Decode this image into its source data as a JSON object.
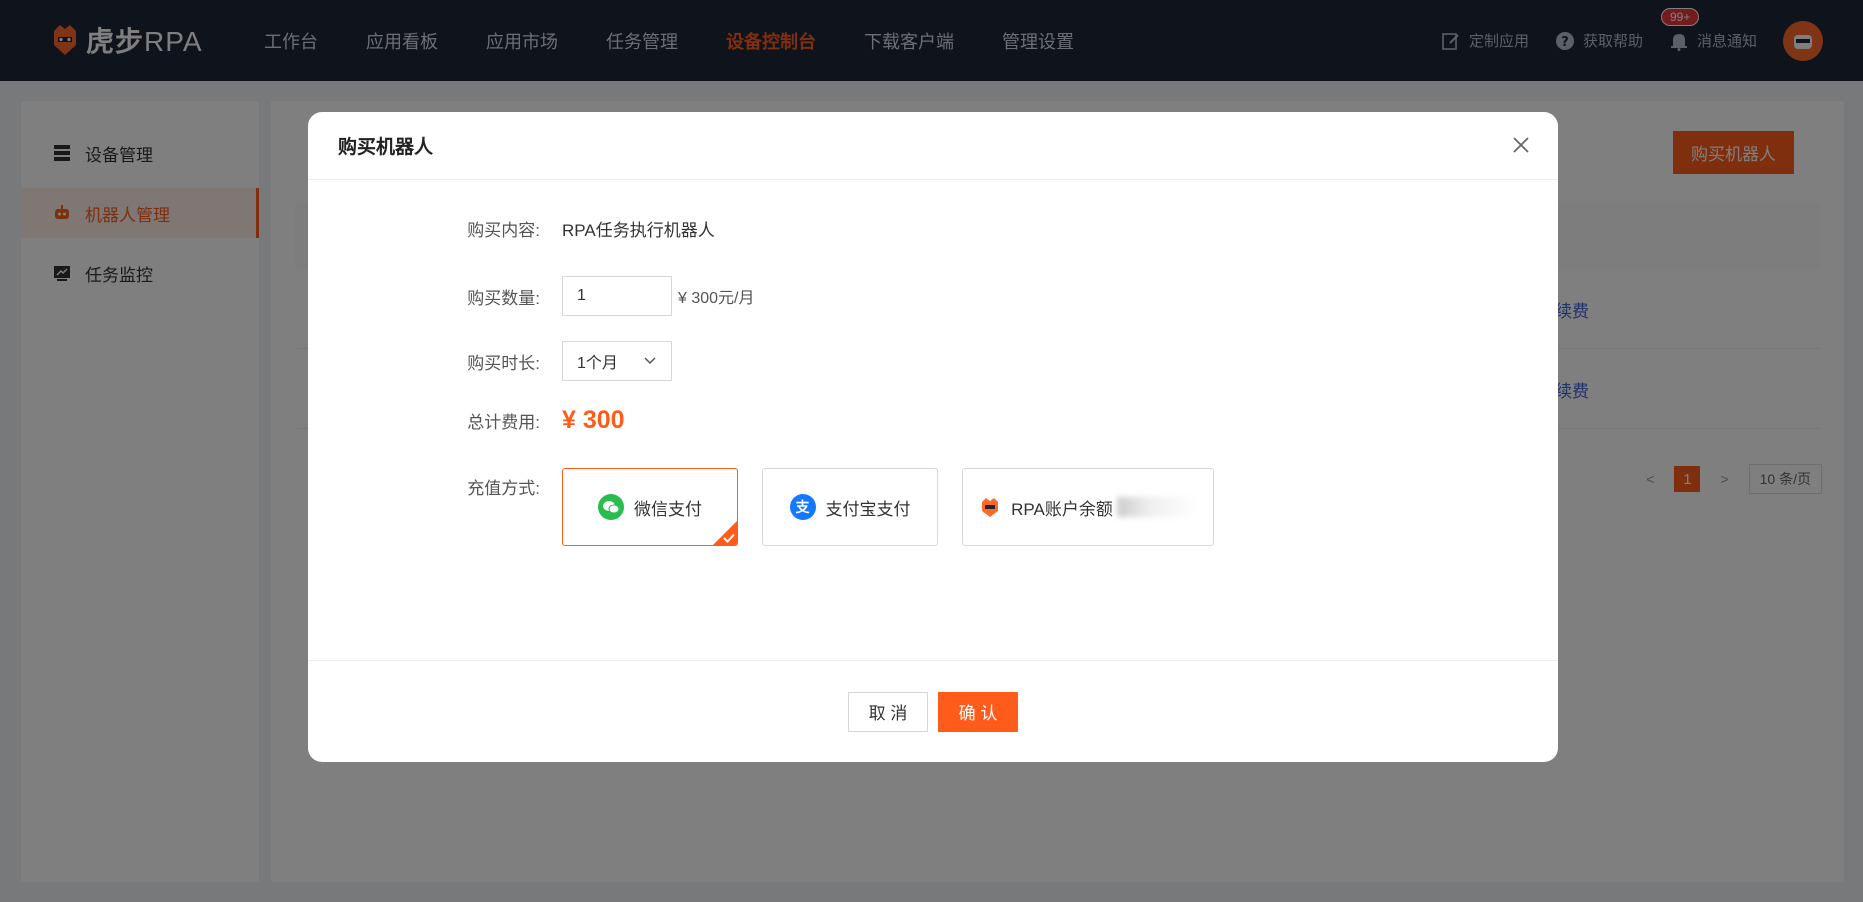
{
  "brand": {
    "name_cn": "虎步",
    "name_en": "RPA"
  },
  "nav": {
    "items": [
      {
        "label": "工作台"
      },
      {
        "label": "应用看板"
      },
      {
        "label": "应用市场"
      },
      {
        "label": "任务管理"
      },
      {
        "label": "设备控制台",
        "active": true
      },
      {
        "label": "下载客户端"
      },
      {
        "label": "管理设置"
      }
    ],
    "actions": {
      "custom_app": "定制应用",
      "help": "获取帮助",
      "notifications": "消息通知",
      "notif_badge": "99+"
    }
  },
  "sidebar": {
    "items": [
      {
        "label": "设备管理"
      },
      {
        "label": "机器人管理",
        "active": true
      },
      {
        "label": "任务监控"
      }
    ]
  },
  "main": {
    "buy_button": "购买机器人",
    "rows": [
      {
        "link": "续费"
      },
      {
        "link": "续费"
      }
    ],
    "pager": {
      "prev": "<",
      "current": "1",
      "next": ">",
      "page_size": "10 条/页"
    }
  },
  "dialog": {
    "title": "购买机器人",
    "content_label": "购买内容:",
    "content_value": "RPA任务执行机器人",
    "qty_label": "购买数量:",
    "qty_value": "1",
    "unit_price": "¥ 300元/月",
    "duration_label": "购买时长:",
    "duration_value": "1个月",
    "total_label": "总计费用:",
    "total_value": "¥ 300",
    "pay_label": "充值方式:",
    "pay_options": [
      {
        "label": "微信支付",
        "selected": true
      },
      {
        "label": "支付宝支付",
        "icon_text": "支"
      },
      {
        "label": "RPA账户余额"
      }
    ],
    "cancel": "取 消",
    "confirm": "确 认"
  },
  "colors": {
    "accent": "#ff5c1c",
    "topbar": "#1f2638",
    "link": "#3a64d8"
  }
}
